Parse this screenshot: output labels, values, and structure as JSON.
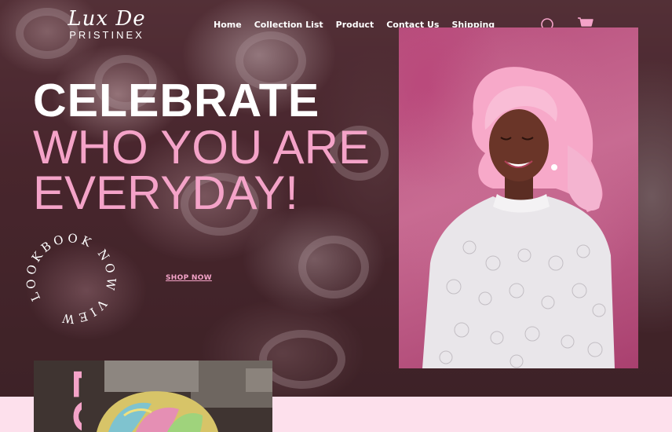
{
  "brand": {
    "script": "Lux De",
    "sub": "PRISTINEX"
  },
  "nav": {
    "items": [
      {
        "label": "Home"
      },
      {
        "label": "Collection List"
      },
      {
        "label": "Product"
      },
      {
        "label": "Contact Us"
      },
      {
        "label": "Shipping"
      }
    ]
  },
  "icons": {
    "search": "search-icon",
    "cart": "cart-icon"
  },
  "hero": {
    "line1": "CELEBRATE",
    "line2": "WHO YOU ARE",
    "line3": "EVERYDAY!",
    "lookbook_ring": "LOOKBOOK NOW VIEW",
    "shop_now": "SHOP NOW"
  },
  "bottom": {
    "video_label": "EO"
  },
  "colors": {
    "accent_pink": "#f4a3c8",
    "band_pink": "#fde0ec",
    "white": "#ffffff"
  }
}
